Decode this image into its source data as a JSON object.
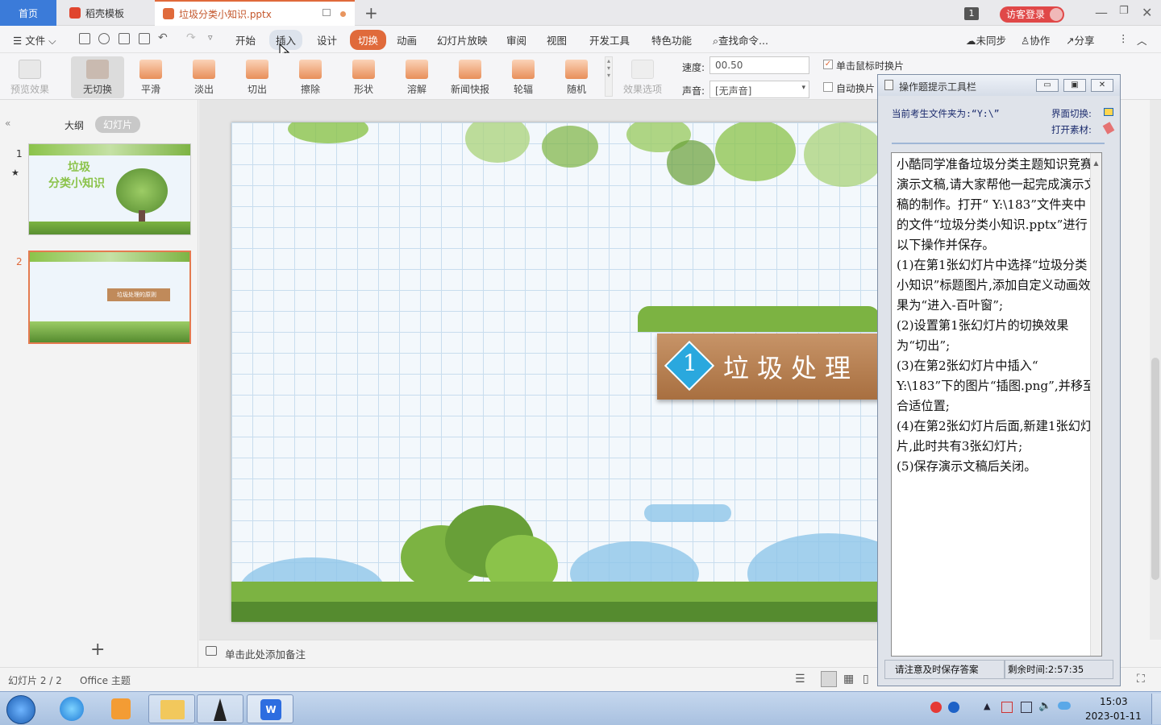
{
  "tabs": {
    "home": "首页",
    "docer": "稻壳模板",
    "pptx": "垃圾分类小知识.pptx"
  },
  "window": {
    "count_badge": "1",
    "login": "访客登录"
  },
  "menu": {
    "file": "文件",
    "items": [
      "开始",
      "插入",
      "设计",
      "切换",
      "动画",
      "幻灯片放映",
      "审阅",
      "视图",
      "开发工具",
      "特色功能"
    ],
    "search": "查找命令...",
    "sync": "未同步",
    "collab": "协作",
    "share": "分享"
  },
  "ribbon": {
    "preview": "预览效果",
    "transitions": [
      "无切换",
      "平滑",
      "淡出",
      "切出",
      "擦除",
      "形状",
      "溶解",
      "新闻快报",
      "轮辐",
      "随机"
    ],
    "effect_options": "效果选项",
    "speed_label": "速度:",
    "speed_value": "00.50",
    "sound_label": "声音:",
    "sound_value": "[无声音]",
    "on_click": "单击鼠标时换片",
    "auto": "自动换片"
  },
  "left_panel": {
    "outline": "大纲",
    "slides": "幻灯片",
    "slide_numbers": [
      "1",
      "2"
    ],
    "thumb1_title_line1": "垃圾",
    "thumb1_title_line2": "分类小知识",
    "thumb2_banner": "垃圾处理的原则"
  },
  "slide": {
    "banner_number": "1",
    "banner_text": "垃圾处理"
  },
  "notes": {
    "placeholder": "单击此处添加备注"
  },
  "status": {
    "slide_info": "幻灯片 2 / 2",
    "theme": "Office 主题"
  },
  "tool": {
    "title": "操作题提示工具栏",
    "folder_label": "当前考生文件夹为:“Y:\\”",
    "switch_label": "界面切换:",
    "open_label": "打开素材:",
    "paragraphs": [
      "小酷同学准备垃圾分类主题知识竞赛演示文稿,请大家帮他一起完成演示文稿的制作。打开“ Y:\\183”文件夹中的文件“垃圾分类小知识.pptx”进行以下操作并保存。",
      "(1)在第1张幻灯片中选择“垃圾分类小知识”标题图片,添加自定义动画效果为“进入-百叶窗”;",
      "(2)设置第1张幻灯片的切换效果为“切出”;",
      "(3)在第2张幻灯片中插入“ Y:\\183”下的图片“插图.png”,并移至合适位置;",
      "(4)在第2张幻灯片后面,新建1张幻灯片,此时共有3张幻灯片;",
      "(5)保存演示文稿后关闭。"
    ],
    "save_notice": "请注意及时保存答案",
    "time_left": "剩余时间:2:57:35"
  },
  "taskbar": {
    "time": "15:03",
    "date": "2023-01-11"
  },
  "colors": {
    "accent": "#e06a3b",
    "home_tab": "#3b7bd9",
    "login": "#e04848"
  }
}
